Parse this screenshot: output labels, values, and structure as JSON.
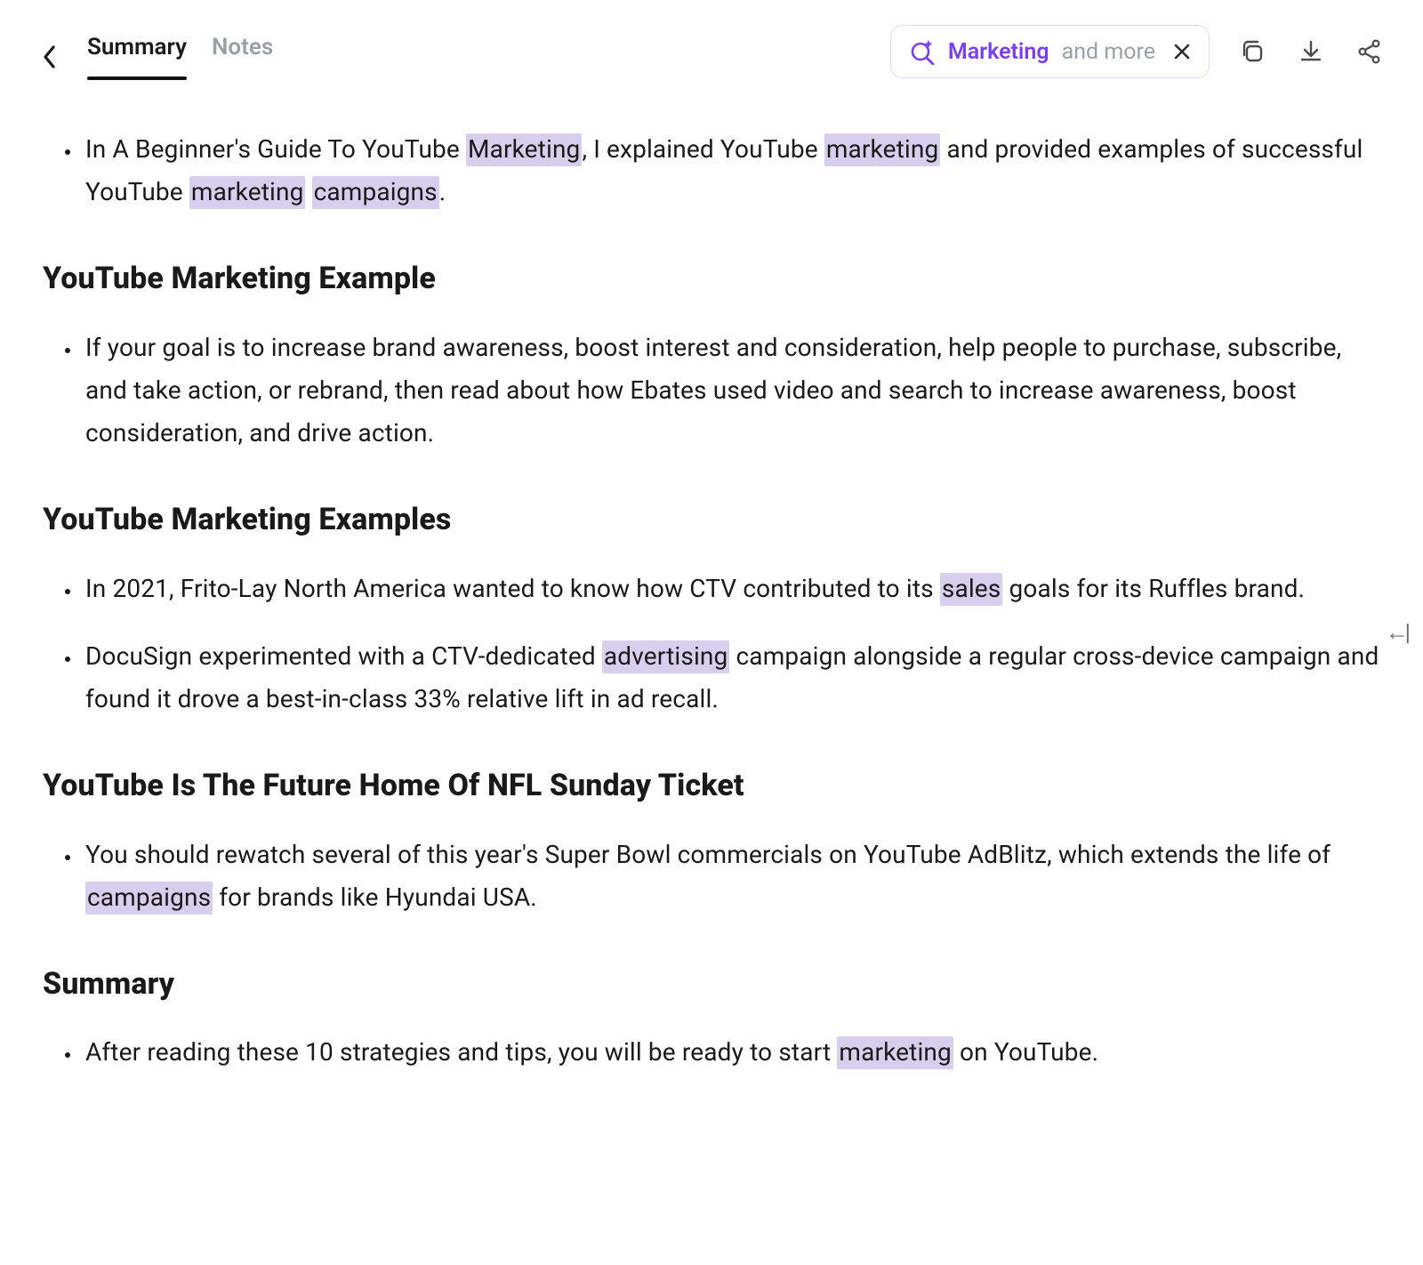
{
  "header": {
    "tabs": [
      {
        "id": "summary",
        "label": "Summary",
        "active": true
      },
      {
        "id": "notes",
        "label": "Notes",
        "active": false
      }
    ],
    "search": {
      "term": "Marketing",
      "suffix": "and more"
    }
  },
  "highlight_terms": [
    "marketing",
    "sales",
    "advertising",
    "campaigns"
  ],
  "sections": [
    {
      "heading": null,
      "bullets": [
        "In A Beginner's Guide To YouTube Marketing, I explained YouTube marketing and provided examples of successful YouTube marketing campaigns."
      ]
    },
    {
      "heading": "YouTube Marketing Example",
      "bullets": [
        "If your goal is to increase brand awareness, boost interest and consideration, help people to purchase, subscribe, and take action, or rebrand, then read about how Ebates used video and search to increase awareness, boost consideration, and drive action."
      ]
    },
    {
      "heading": "YouTube Marketing Examples",
      "bullets": [
        "In 2021, Frito-Lay North America wanted to know how CTV contributed to its sales goals for its Ruffles brand.",
        "DocuSign experimented with a CTV-dedicated advertising campaign alongside a regular cross-device campaign and found it drove a best-in-class 33% relative lift in ad recall."
      ]
    },
    {
      "heading": "YouTube Is The Future Home Of NFL Sunday Ticket",
      "bullets": [
        "You should rewatch several of this year's Super Bowl commercials on YouTube AdBlitz, which extends the life of campaigns for brands like Hyundai USA."
      ]
    },
    {
      "heading": "Summary",
      "bullets": [
        "After reading these 10 strategies and tips, you will be ready to start marketing on YouTube."
      ]
    }
  ]
}
